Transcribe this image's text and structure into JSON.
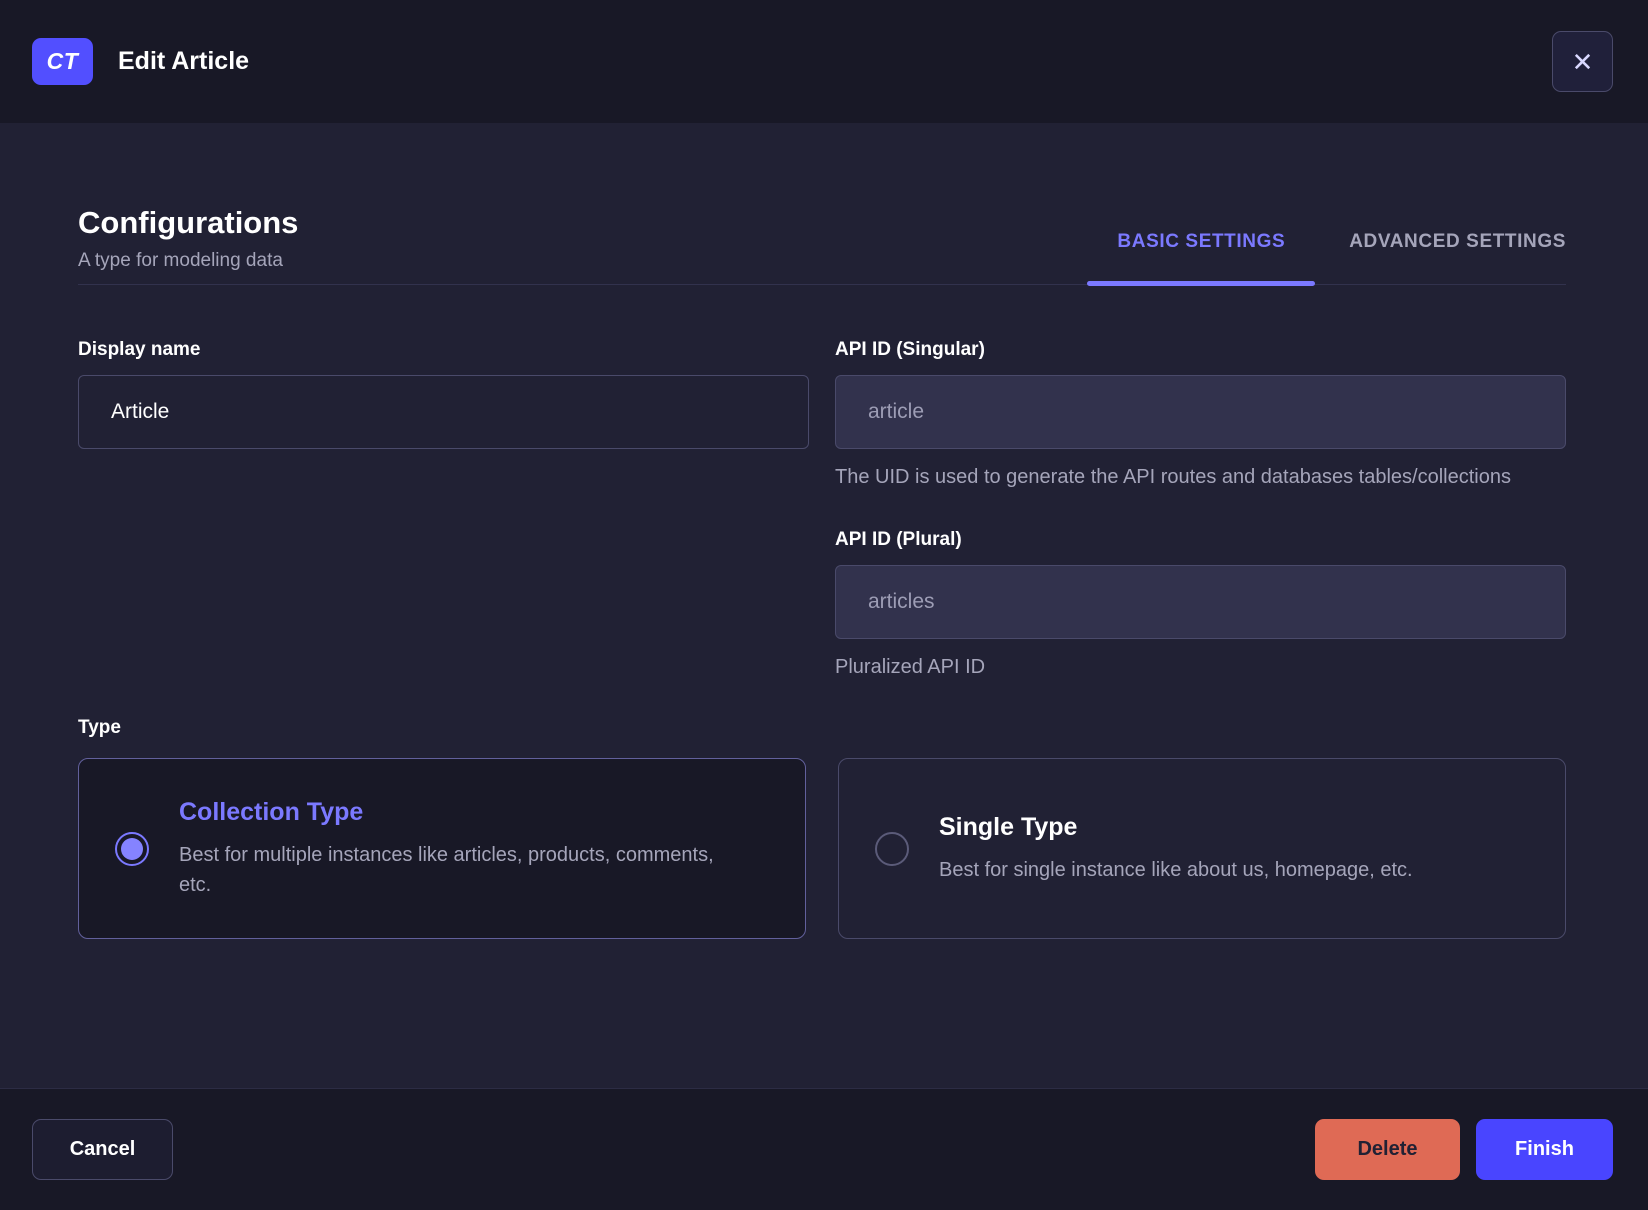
{
  "header": {
    "badge": "CT",
    "title": "Edit Article",
    "close_icon": "✕"
  },
  "section": {
    "title": "Configurations",
    "subtitle": "A type for modeling data"
  },
  "tabs": [
    {
      "label": "BASIC SETTINGS",
      "active": true
    },
    {
      "label": "ADVANCED SETTINGS",
      "active": false
    }
  ],
  "form": {
    "display_name": {
      "label": "Display name",
      "value": "Article"
    },
    "api_id_singular": {
      "label": "API ID (Singular)",
      "value": "article",
      "hint": "The UID is used to generate the API routes and databases tables/collections"
    },
    "api_id_plural": {
      "label": "API ID (Plural)",
      "value": "articles",
      "hint": "Pluralized API ID"
    },
    "type": {
      "label": "Type",
      "options": [
        {
          "title": "Collection Type",
          "description": "Best for multiple instances like articles, products, comments, etc.",
          "selected": true
        },
        {
          "title": "Single Type",
          "description": "Best for single instance like about us, homepage, etc.",
          "selected": false
        }
      ]
    }
  },
  "footer": {
    "cancel_label": "Cancel",
    "delete_label": "Delete",
    "finish_label": "Finish"
  },
  "colors": {
    "accent": "#4945ff",
    "accent_light": "#7b79ff",
    "badge": "#524fff",
    "danger": "#df6a55",
    "header_bg": "#181826",
    "body_bg": "#212134"
  }
}
